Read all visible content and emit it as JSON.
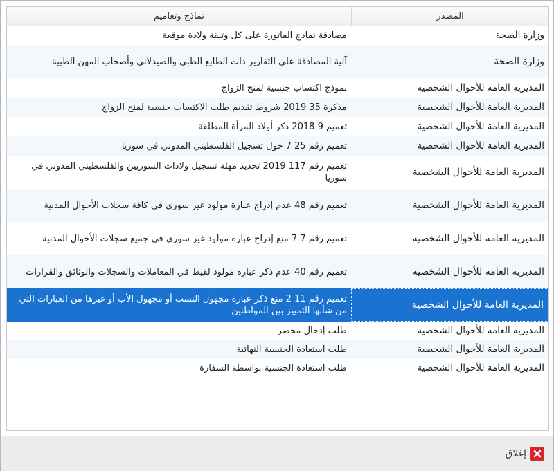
{
  "table": {
    "headers": {
      "source": "المصدر",
      "forms": "نماذج وتعاميم"
    },
    "rows": [
      {
        "source": "وزارة الصحة",
        "forms": "مصادقة نماذج الفاتورة على كل وثيقة ولادة موقعة"
      },
      {
        "source": "وزارة الصحة",
        "forms": "آلية المصادقة على التقارير ذات الطابع الطبي والصيدلاني وأصحاب المهن الطبية"
      },
      {
        "source": "المديرية العامة للأحوال الشخصية",
        "forms": "نموذج اكتساب جنسية لمنح الزواج"
      },
      {
        "source": "المديرية العامة للأحوال الشخصية",
        "forms": "مذكرة 35 2019 شروط تقديم طلب الاكتساب جنسية لمنح الزواج"
      },
      {
        "source": "المديرية العامة للأحوال الشخصية",
        "forms": "تعميم 9 2018 ذكر أولاد المرأة المطلقة"
      },
      {
        "source": "المديرية العامة للأحوال الشخصية",
        "forms": "تعميم رقم 25 7 حول تسجيل الفلسطيني المدوني في سوريا"
      },
      {
        "source": "المديرية العامة للأحوال الشخصية",
        "forms": "تعميم رقم 117 2019 تحديد مهلة تسجيل ولادات السوريين والفلسطيني المدوني في سوريا"
      },
      {
        "source": "المديرية العامة للأحوال الشخصية",
        "forms": "تعميم رقم 48 عدم إدراج عبارة مولود غير سوري في كافة سجلات الأحوال المدنية"
      },
      {
        "source": "المديرية العامة للأحوال الشخصية",
        "forms": "تعميم رقم 7 7 منع إدراج عبارة مولود غير سوري في جميع سجلات الأحوال المدنية"
      },
      {
        "source": "المديرية العامة للأحوال الشخصية",
        "forms": "تعميم رقم 40 عدم ذكر عبارة مولود لقيط في المعاملات والسجلات والوثائق والقرارات"
      },
      {
        "source": "المديرية العامة للأحوال الشخصية",
        "forms": "تعميم رقم 11 2 منع ذكر عبارة مجهول النسب أو مجهول الأب أو غيرها من العبارات التي من شأنها التمييز بين المواطنين"
      },
      {
        "source": "المديرية العامة للأحوال الشخصية",
        "forms": "طلب إدخال محضر"
      },
      {
        "source": "المديرية العامة للأحوال الشخصية",
        "forms": "طلب استعادة الجنسية النهائية"
      },
      {
        "source": "المديرية العامة للأحوال الشخصية",
        "forms": "طلب استعادة الجنسية بواسطة السفارة"
      }
    ],
    "selected_index": 10
  },
  "footer": {
    "close_label": "إغلاق"
  },
  "colors": {
    "selection": "#1a73d0",
    "close_icon_bg": "#d9262c"
  }
}
